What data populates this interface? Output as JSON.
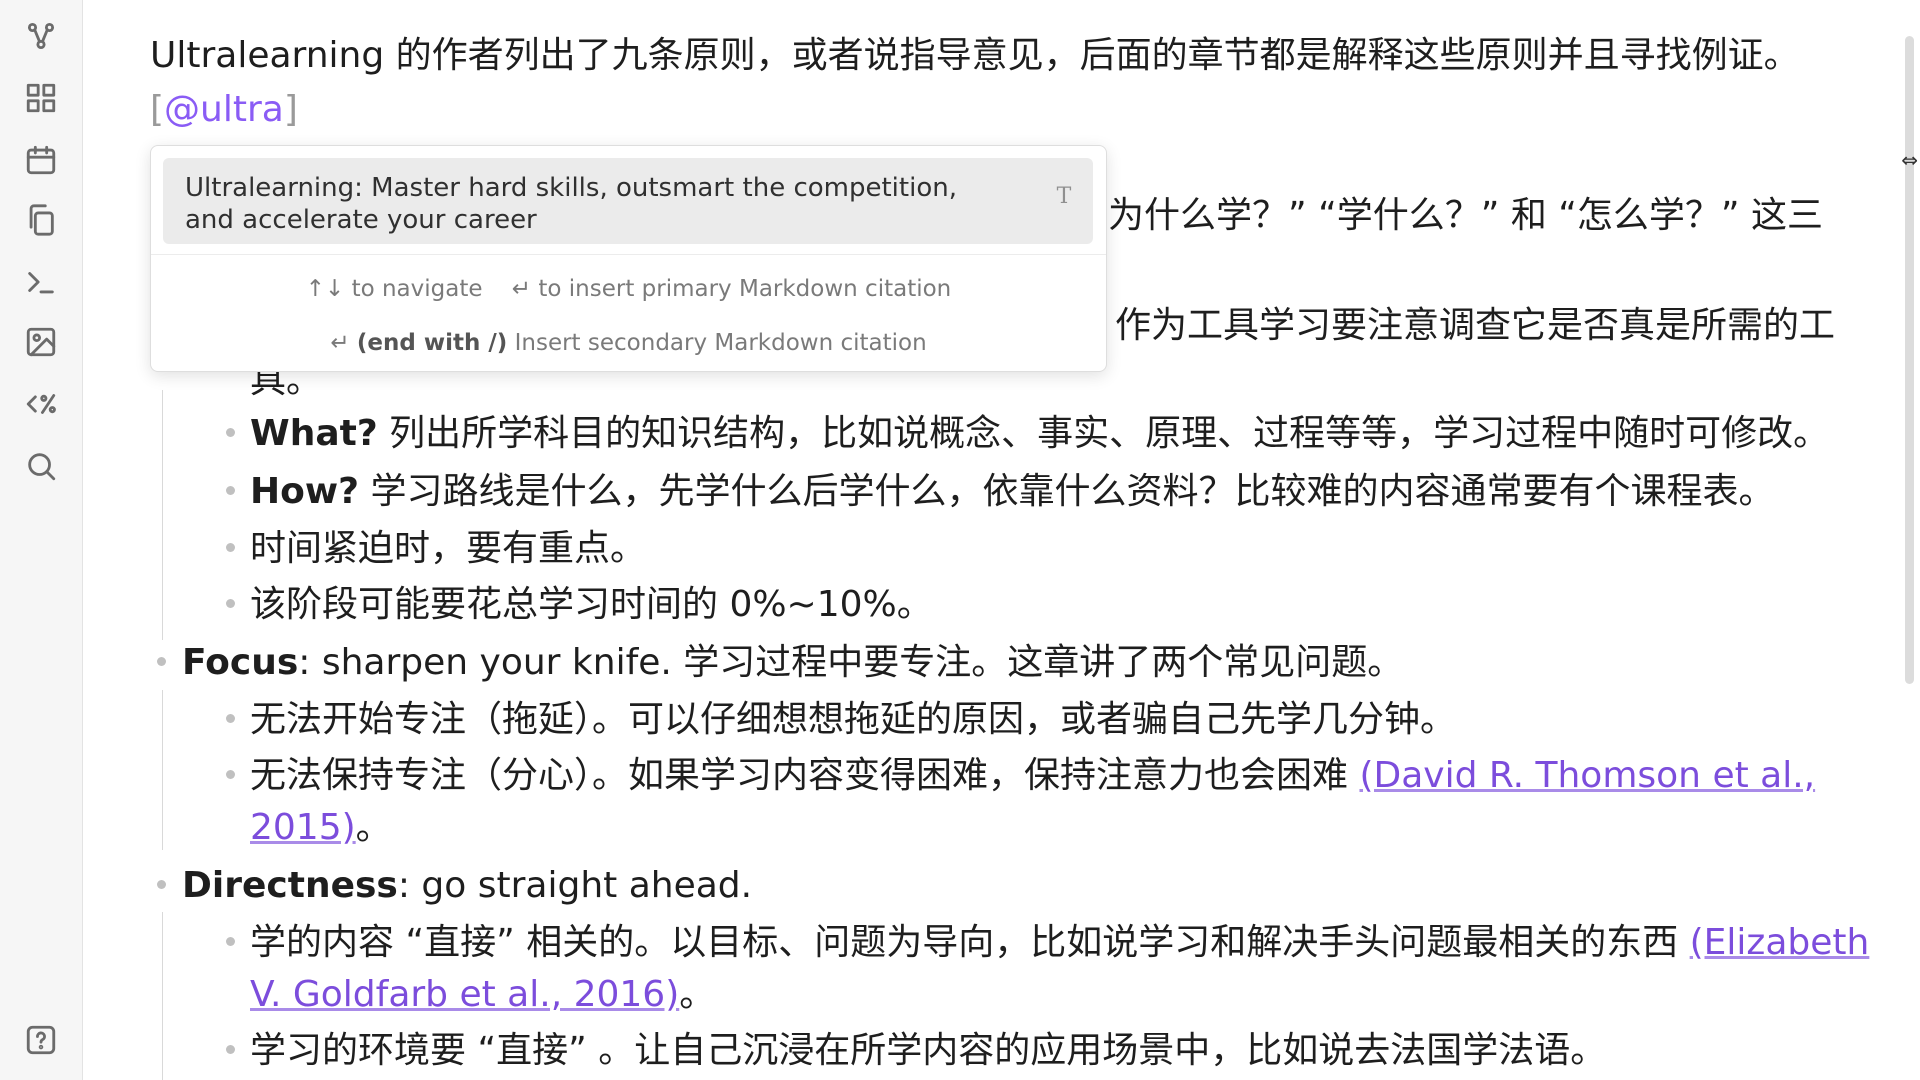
{
  "ribbon": {
    "icons": [
      "graph-view-icon",
      "canvas-icon",
      "calendar-icon",
      "copy-icon",
      "terminal-icon",
      "image-icon",
      "code-percent-icon",
      "search-icon",
      "help-icon"
    ]
  },
  "editor": {
    "intro_text": "Ultralearning 的作者列出了九条原则，或者说指导意见，后面的章节都是解释这些原则并且寻找例证。",
    "citation_open": "[",
    "citation_key": "@ultra",
    "citation_close": "]",
    "partial_line_1": "为什么学？”  “学什么？” 和 “怎么学？” 这三",
    "partial_line_2": "作为工具学习要注意调查它是否真是所需的工",
    "partial_line_3": "具。",
    "items": [
      {
        "bold": "What?",
        "text": " 列出所学科目的知识结构，比如说概念、事实、原理、过程等等，学习过程中随时可修改。"
      },
      {
        "bold": "How?",
        "text": " 学习路线是什么，先学什么后学什么，依靠什么资料？比较难的内容通常要有个课程表。"
      },
      {
        "bold": "",
        "text": "时间紧迫时，要有重点。"
      },
      {
        "bold": "",
        "text": "该阶段可能要花总学习时间的 0%~10%。"
      }
    ],
    "focus": {
      "bold": "Focus",
      "text": ": sharpen your knife. 学习过程中要专注。这章讲了两个常见问题。"
    },
    "focus_items": [
      {
        "text": "无法开始专注（拖延）。可以仔细想想拖延的原因，或者骗自己先学几分钟。"
      },
      {
        "text": "无法保持专注（分心）。如果学习内容变得困难，保持注意力也会困难 ",
        "link": "(David R. Thomson et al.,",
        "link2": "2015)",
        "tail": "。"
      }
    ],
    "directness": {
      "bold": "Directness",
      "text": ": go straight ahead."
    },
    "directness_items": [
      {
        "text": "学的内容 “直接” 相关的。以目标、问题为导向，比如说学习和解决手头问题最相关的东西 ",
        "link": "(Elizabeth",
        "link2": "V. Goldfarb et al., 2016)",
        "tail": "。"
      },
      {
        "text": "学习的环境要 “直接” 。让自己沉浸在所学内容的应用场景中，比如说去法国学法语。"
      }
    ]
  },
  "popup": {
    "suggestion_title": "Ultralearning: Master hard skills, outsmart the competition, and accelerate your career",
    "flair": "T",
    "nav_keys": "↑↓",
    "nav_text": "to navigate",
    "enter_key": "↵",
    "enter_text": "to insert primary Markdown citation",
    "secondary_key": "↵",
    "secondary_bold": "(end with /)",
    "secondary_text": "Insert secondary Markdown citation"
  }
}
